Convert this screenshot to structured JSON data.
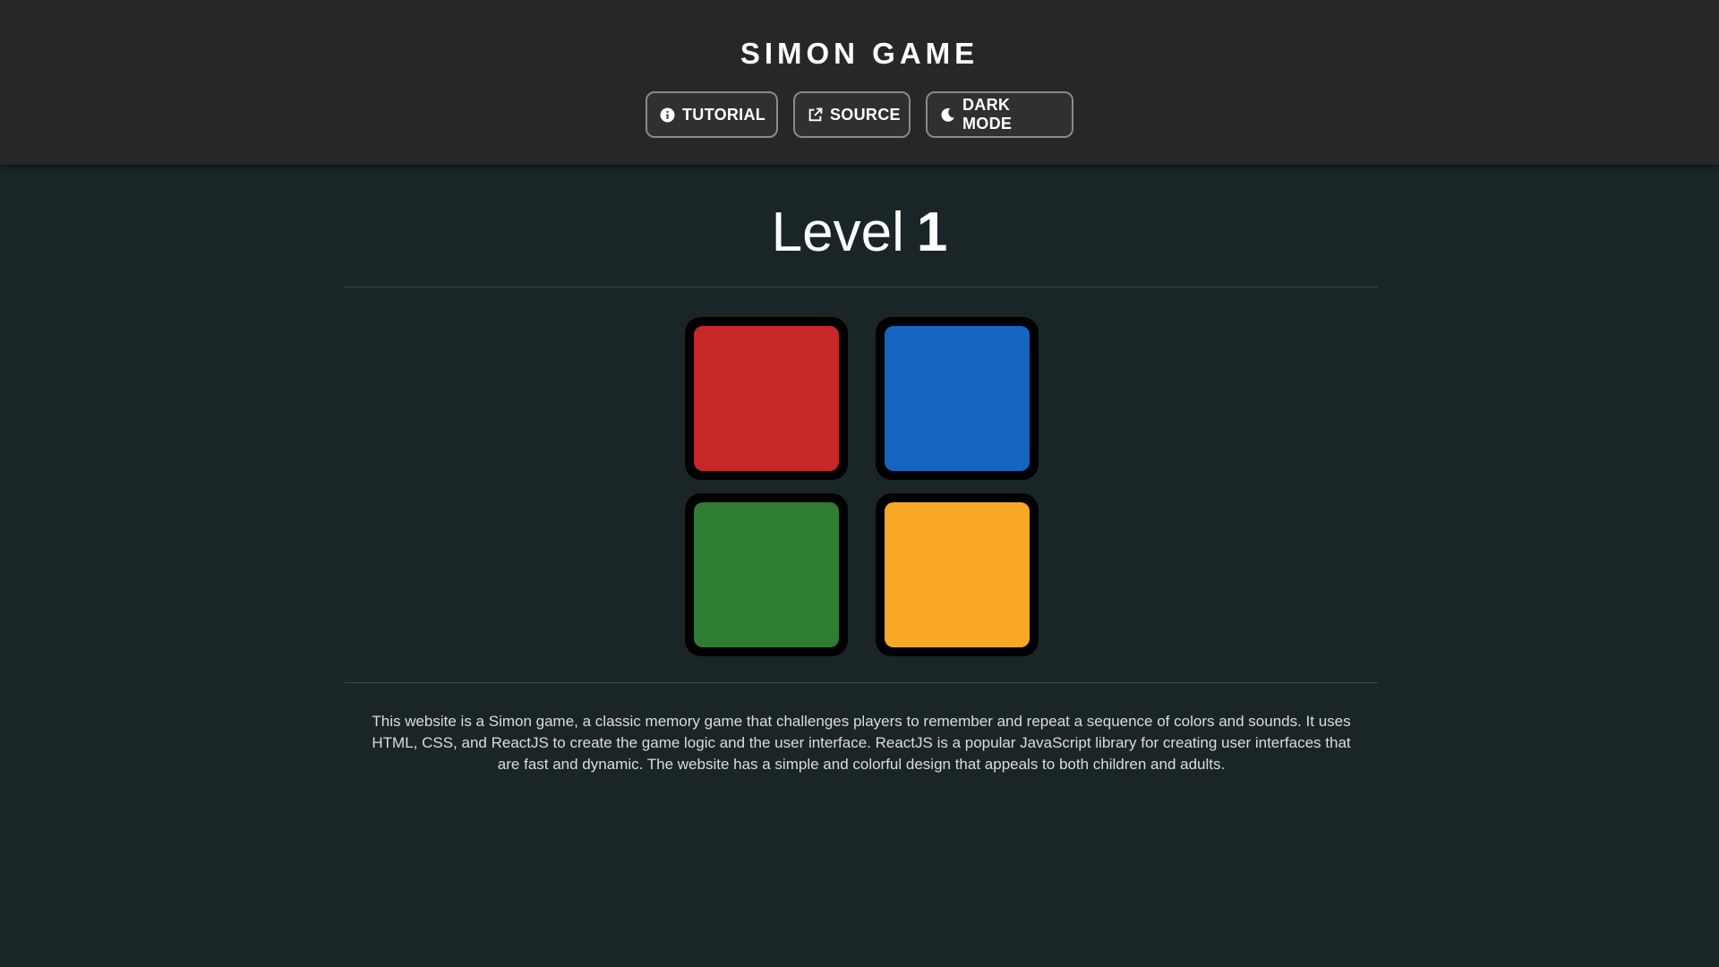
{
  "header": {
    "title": "SIMON GAME",
    "buttons": {
      "tutorial": {
        "label": "TUTORIAL",
        "icon": "info-icon"
      },
      "source": {
        "label": "SOURCE",
        "icon": "external-link-icon"
      },
      "dark_mode": {
        "label": "DARK MODE",
        "icon": "moon-icon"
      }
    }
  },
  "game": {
    "level_label": "Level",
    "level_value": "1",
    "pads": [
      {
        "name": "red",
        "color": "#c62828"
      },
      {
        "name": "blue",
        "color": "#1565c0"
      },
      {
        "name": "green",
        "color": "#2e7d32"
      },
      {
        "name": "yellow",
        "color": "#f9a825"
      }
    ]
  },
  "description": "This website is a Simon game, a classic memory game that challenges players to remember and repeat a sequence of colors and sounds. It uses HTML, CSS, and ReactJS to create the game logic and the user interface. ReactJS is a popular JavaScript library for creating user interfaces that are fast and dynamic. The website has a simple and colorful design that appeals to both children and adults."
}
